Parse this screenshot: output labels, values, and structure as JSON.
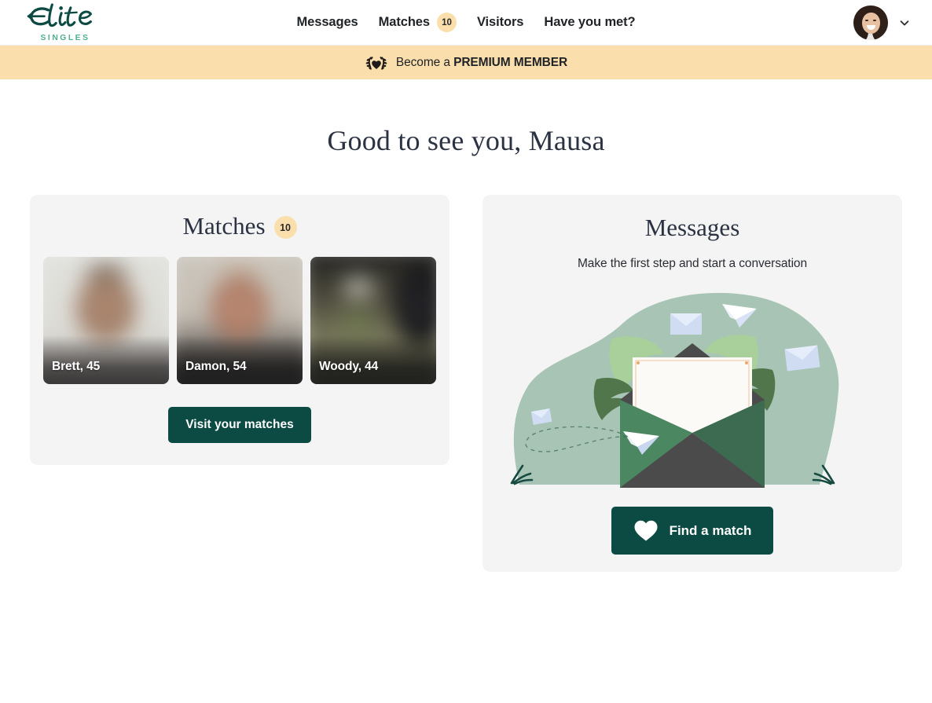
{
  "brand": {
    "name": "Elite",
    "tagline": "SINGLES",
    "logo_color": "#0d4a44",
    "tagline_color": "#4fb08d"
  },
  "header": {
    "nav": [
      {
        "label": "Messages",
        "badge": null
      },
      {
        "label": "Matches",
        "badge": "10"
      },
      {
        "label": "Visitors",
        "badge": null
      },
      {
        "label": "Have you met?",
        "badge": null
      }
    ],
    "account": {
      "avatar_alt": "user-avatar",
      "chevron": "chevron-down-icon"
    }
  },
  "banner": {
    "icon": "laurel-wreath-heart-icon",
    "text_prefix": "Become a ",
    "text_strong": "PREMIUM MEMBER",
    "background": "#fadfad"
  },
  "main": {
    "greeting": "Good to see you, Mausa"
  },
  "matches_card": {
    "title": "Matches",
    "badge": "10",
    "tiles": [
      {
        "name": "Brett, 45"
      },
      {
        "name": "Damon, 54"
      },
      {
        "name": "Woody, 44"
      }
    ],
    "button_label": "Visit your matches"
  },
  "messages_card": {
    "title": "Messages",
    "subtitle": "Make the first step and start a conversation",
    "illustration": "open-envelope-with-letter-illustration",
    "button_label": "Find a match",
    "button_icon": "heart-icon"
  },
  "colors": {
    "accent_teal": "#0c4a44",
    "cream": "#fadfad",
    "card_bg": "#f4f4f4",
    "blob_green": "#a7c4b5",
    "envelope_green": "#3d6b51",
    "envelope_dark": "#4b4b4b"
  }
}
